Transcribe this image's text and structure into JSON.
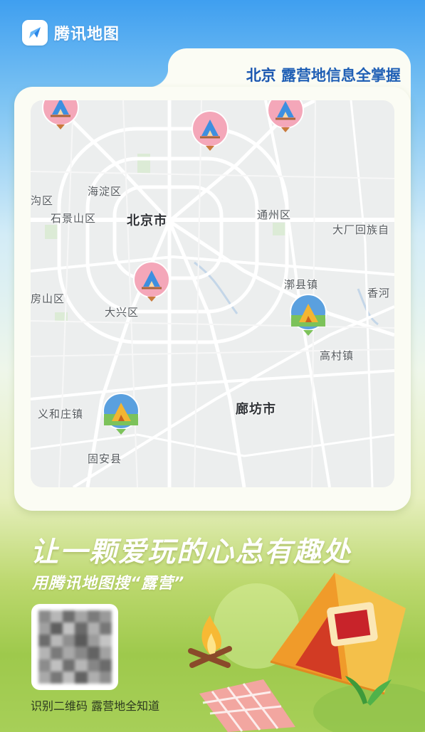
{
  "brand": {
    "name": "腾讯地图",
    "logo_icon": "tencent-map-logo-icon"
  },
  "headline": {
    "city": "北京",
    "text": " 露营地信息全掌握"
  },
  "map": {
    "labels": {
      "beijing": "北京市",
      "haidian": "海淀区",
      "shijingshan": "石景山区",
      "mentougou": "沟区",
      "fangshan": "房山区",
      "tongzhou": "通州区",
      "dachang": "大厂回族自",
      "daxing": "大兴区",
      "taixian": "漷县镇",
      "xianghe": "香河",
      "gaocun": "高村镇",
      "yihezhuang": "义和庄镇",
      "langfang": "廊坊市",
      "guan": "固安县"
    },
    "pins": [
      "camp-tent-pin-icon",
      "camp-tent-pin-icon",
      "camp-tent-pin-icon",
      "camp-tent-pin-icon",
      "camp-yellow-tent-pin-icon",
      "camp-yellow-tent-pin-icon"
    ]
  },
  "promo": {
    "slogan": "让一颗爱玩的心总有趣处",
    "sub": "用腾讯地图搜“露营”"
  },
  "qr": {
    "caption": "识别二维码 露营地全知道",
    "icon": "qr-code-icon"
  },
  "colors": {
    "brand_blue": "#1f5fb5",
    "sky": "#3f9ff0",
    "grass": "#9ec94c"
  }
}
